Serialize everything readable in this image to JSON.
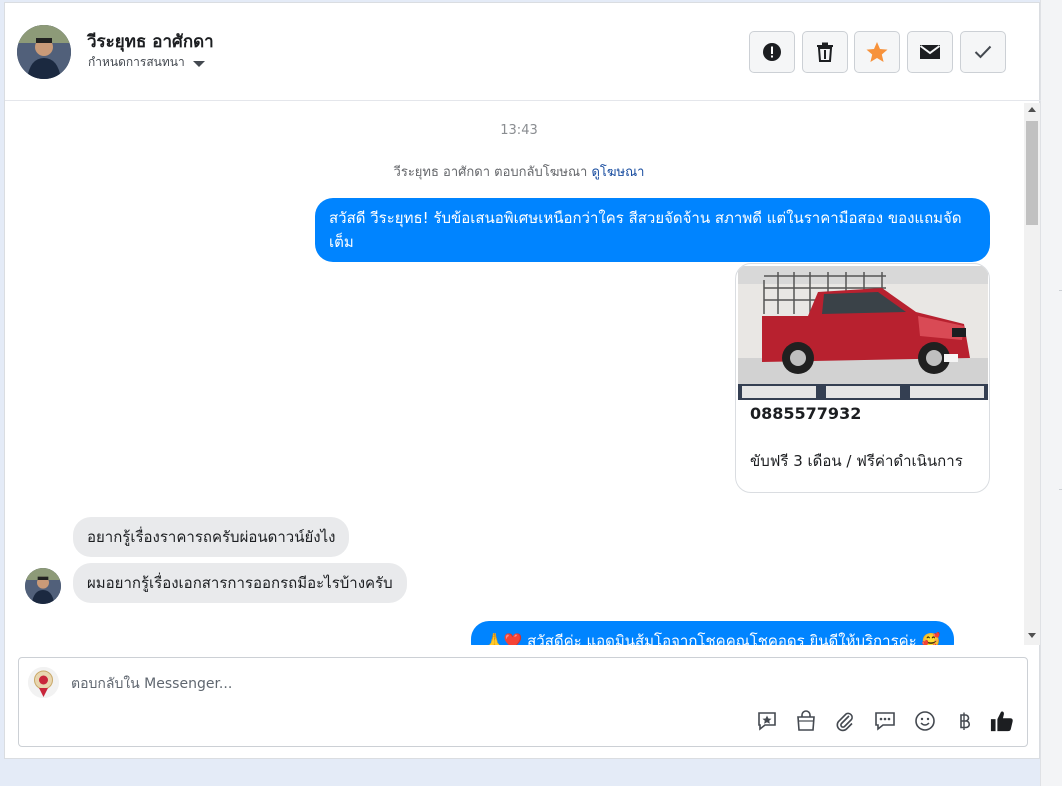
{
  "header": {
    "contact_name": "วีระยุทธ อาศักดา",
    "settings_label": "กำหนดการสนทนา"
  },
  "thread": {
    "timestamp": "13:43",
    "ad_reply_text": "วีระยุทธ อาศักดา ตอบกลับโฆษณา",
    "ad_reply_link": "ดูโฆษณา",
    "messages": [
      {
        "text": "สวัสดี วีระยุทธ! รับข้อเสนอพิเศษเหนือกว่าใคร สีสวยจัดจ้าน สภาพดี แต่ในราคามือสอง ของแถมจัดเต็ม"
      },
      {
        "text": "อยากรู้เรื่องราคารถครับผ่อนดาวน์ยังไง"
      },
      {
        "text": "ผมอยากรู้เรื่องเอกสารการออกรถมีอะไรบ้างครับ"
      },
      {
        "text": "🙏❤️ สวัสดีค่ะ แอดมินส้มโอจากโชคคูณโชคอดร ยินดีให้บริการค่ะ 🥰"
      }
    ],
    "ad_card": {
      "phone": "0885577932",
      "description": "ขับฟรี 3 เดือน / ฟรีค่าดำเนินการ"
    }
  },
  "composer": {
    "placeholder": "ตอบกลับใน Messenger..."
  },
  "colors": {
    "outgoing_bubble": "#0084ff",
    "incoming_bubble": "#e9eaec",
    "star": "#f7923b",
    "link": "#1a4ea0"
  }
}
